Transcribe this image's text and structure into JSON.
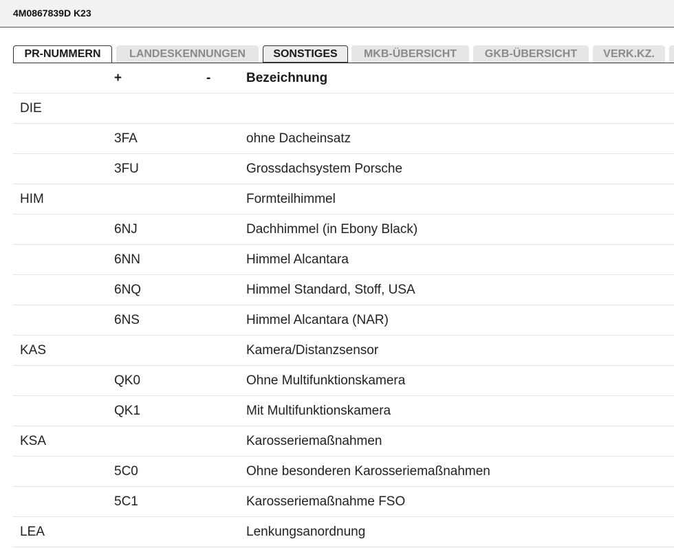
{
  "window": {
    "title": "4M0867839D K23"
  },
  "tabs": [
    {
      "label": "PR-NUMMERN",
      "state": "active"
    },
    {
      "label": "LANDESKENNUNGEN",
      "state": "inactive"
    },
    {
      "label": "SONSTIGES",
      "state": "sel"
    },
    {
      "label": "MKB-ÜBERSICHT",
      "state": "inactive"
    },
    {
      "label": "GKB-ÜBERSICHT",
      "state": "inactive"
    },
    {
      "label": "VERK.KZ.",
      "state": "inactive"
    }
  ],
  "table": {
    "headers": {
      "group": "",
      "plus": "+",
      "minus": "-",
      "desc": "Bezeichnung"
    },
    "rows": [
      {
        "group": "DIE",
        "plus": "",
        "minus": "",
        "desc": ""
      },
      {
        "group": "",
        "plus": "3FA",
        "minus": "",
        "desc": "ohne Dacheinsatz"
      },
      {
        "group": "",
        "plus": "3FU",
        "minus": "",
        "desc": "Grossdachsystem Porsche"
      },
      {
        "group": "HIM",
        "plus": "",
        "minus": "",
        "desc": "Formteilhimmel"
      },
      {
        "group": "",
        "plus": "6NJ",
        "minus": "",
        "desc": "Dachhimmel (in Ebony Black)"
      },
      {
        "group": "",
        "plus": "6NN",
        "minus": "",
        "desc": "Himmel Alcantara"
      },
      {
        "group": "",
        "plus": "6NQ",
        "minus": "",
        "desc": "Himmel Standard, Stoff, USA"
      },
      {
        "group": "",
        "plus": "6NS",
        "minus": "",
        "desc": "Himmel Alcantara (NAR)"
      },
      {
        "group": "KAS",
        "plus": "",
        "minus": "",
        "desc": "Kamera/Distanzsensor"
      },
      {
        "group": "",
        "plus": "QK0",
        "minus": "",
        "desc": "Ohne Multifunktionskamera"
      },
      {
        "group": "",
        "plus": "QK1",
        "minus": "",
        "desc": "Mit Multifunktionskamera"
      },
      {
        "group": "KSA",
        "plus": "",
        "minus": "",
        "desc": "Karosseriemaßnahmen"
      },
      {
        "group": "",
        "plus": "5C0",
        "minus": "",
        "desc": "Ohne besonderen Karosseriemaßnahmen"
      },
      {
        "group": "",
        "plus": "5C1",
        "minus": "",
        "desc": "Karosseriemaßnahme FSO"
      },
      {
        "group": "LEA",
        "plus": "",
        "minus": "",
        "desc": "Lenkungsanordnung"
      }
    ]
  }
}
